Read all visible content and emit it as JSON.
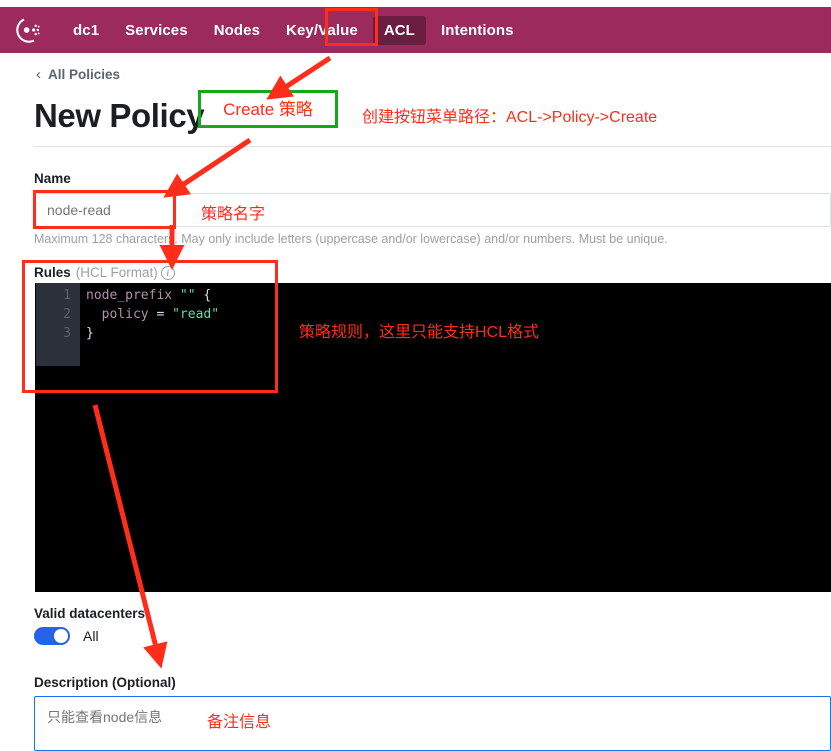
{
  "nav": {
    "logo_name": "consul-logo",
    "items": [
      {
        "label": "dc1",
        "active": false
      },
      {
        "label": "Services",
        "active": false
      },
      {
        "label": "Nodes",
        "active": false
      },
      {
        "label": "Key/Value",
        "active": false
      },
      {
        "label": "ACL",
        "active": true
      },
      {
        "label": "Intentions",
        "active": false
      }
    ],
    "background": "#9c2a5c",
    "active_background": "#6b1d40"
  },
  "breadcrumb": {
    "chevron": "‹",
    "label": "All Policies"
  },
  "page": {
    "title": "New Policy"
  },
  "name_field": {
    "label": "Name",
    "value": "node-read",
    "placeholder": "node-read",
    "helper": "Maximum 128 characters. May only include letters (uppercase and/or lowercase) and/or numbers. Must be unique."
  },
  "rules_field": {
    "label": "Rules",
    "sublabel": "(HCL Format)",
    "info_icon": "info-icon",
    "code_lines": [
      {
        "n": "1",
        "segments": [
          {
            "text": "node_prefix",
            "type": "key"
          },
          {
            "text": " ",
            "type": "plain"
          },
          {
            "text": "\"\"",
            "type": "str"
          },
          {
            "text": " {",
            "type": "plain"
          }
        ]
      },
      {
        "n": "2",
        "segments": [
          {
            "text": "  ",
            "type": "plain"
          },
          {
            "text": "policy",
            "type": "key"
          },
          {
            "text": " = ",
            "type": "plain"
          },
          {
            "text": "\"read\"",
            "type": "str"
          }
        ]
      },
      {
        "n": "3",
        "segments": [
          {
            "text": "}",
            "type": "plain"
          }
        ]
      }
    ],
    "editor_background": "#000000",
    "gutter_background": "#2b303b"
  },
  "datacenters": {
    "label": "Valid datacenters",
    "toggle_on": true,
    "toggle_label": "All",
    "toggle_color": "#2563eb"
  },
  "description_field": {
    "label": "Description (Optional)",
    "value": "只能查看node信息",
    "placeholder": "只能查看node信息",
    "focus_border": "#1a73e8"
  },
  "annotations": {
    "accent_red": "#ff2d1a",
    "accent_green": "#17a81a",
    "create_box_text": "Create 策略",
    "menu_path_note": "创建按钮菜单路径：ACL->Policy->Create",
    "name_note": "策略名字",
    "rules_note": "策略规则，这里只能支持HCL格式",
    "description_note": "备注信息"
  }
}
